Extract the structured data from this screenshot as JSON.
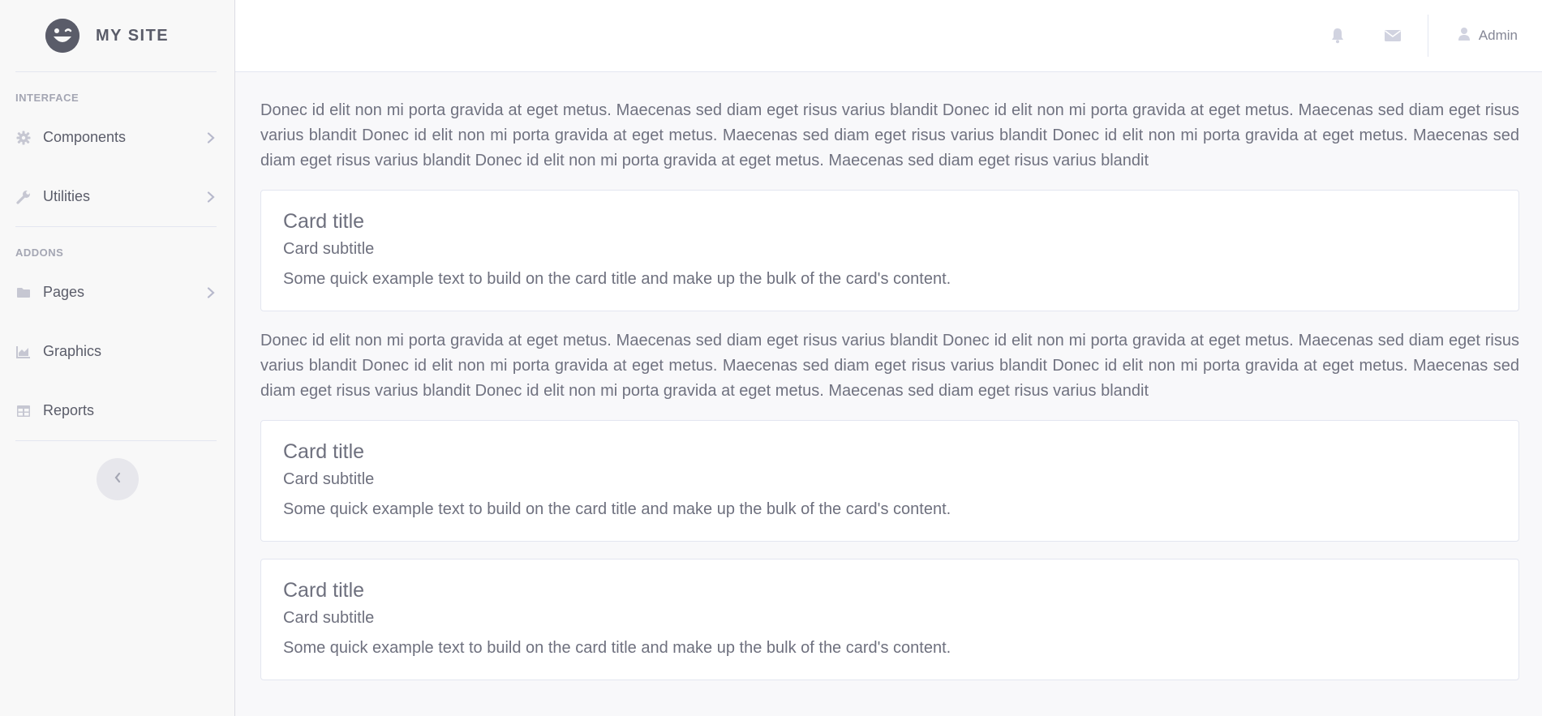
{
  "brand": {
    "name": "MY SITE",
    "logo_icon": "winking-face-icon"
  },
  "sidebar": {
    "sections": [
      {
        "heading": "INTERFACE",
        "items": [
          {
            "label": "Components",
            "icon": "gear-icon",
            "has_submenu": true
          },
          {
            "label": "Utilities",
            "icon": "wrench-icon",
            "has_submenu": true
          }
        ]
      },
      {
        "heading": "ADDONS",
        "items": [
          {
            "label": "Pages",
            "icon": "folder-icon",
            "has_submenu": true
          },
          {
            "label": "Graphics",
            "icon": "area-chart-icon",
            "has_submenu": false
          },
          {
            "label": "Reports",
            "icon": "table-icon",
            "has_submenu": false
          }
        ]
      }
    ],
    "toggle_icon": "chevron-left-icon"
  },
  "topbar": {
    "notifications_icon": "bell-icon",
    "messages_icon": "envelope-icon",
    "user": {
      "icon": "user-icon",
      "label": "Admin"
    }
  },
  "content": {
    "paragraph_1": "Donec id elit non mi porta gravida at eget metus. Maecenas sed diam eget risus varius blandit Donec id elit non mi porta gravida at eget metus. Maecenas sed diam eget risus varius blandit Donec id elit non mi porta gravida at eget metus. Maecenas sed diam eget risus varius blandit Donec id elit non mi porta gravida at eget metus. Maecenas sed diam eget risus varius blandit Donec id elit non mi porta gravida at eget metus. Maecenas sed diam eget risus varius blandit",
    "card_1": {
      "title": "Card title",
      "subtitle": "Card subtitle",
      "text": "Some quick example text to build on the card title and make up the bulk of the card's content."
    },
    "paragraph_2": "Donec id elit non mi porta gravida at eget metus. Maecenas sed diam eget risus varius blandit Donec id elit non mi porta gravida at eget metus. Maecenas sed diam eget risus varius blandit Donec id elit non mi porta gravida at eget metus. Maecenas sed diam eget risus varius blandit Donec id elit non mi porta gravida at eget metus. Maecenas sed diam eget risus varius blandit Donec id elit non mi porta gravida at eget metus. Maecenas sed diam eget risus varius blandit",
    "card_2": {
      "title": "Card title",
      "subtitle": "Card subtitle",
      "text": "Some quick example text to build on the card title and make up the bulk of the card's content."
    },
    "card_3": {
      "title": "Card title",
      "subtitle": "Card subtitle",
      "text": "Some quick example text to build on the card title and make up the bulk of the card's content."
    }
  },
  "colors": {
    "sidebar_bg": "#f8f8f8",
    "main_bg": "#f8f8fa",
    "text": "#6e707e",
    "icon": "#b7b9cc",
    "logo": "#5a5c69"
  }
}
